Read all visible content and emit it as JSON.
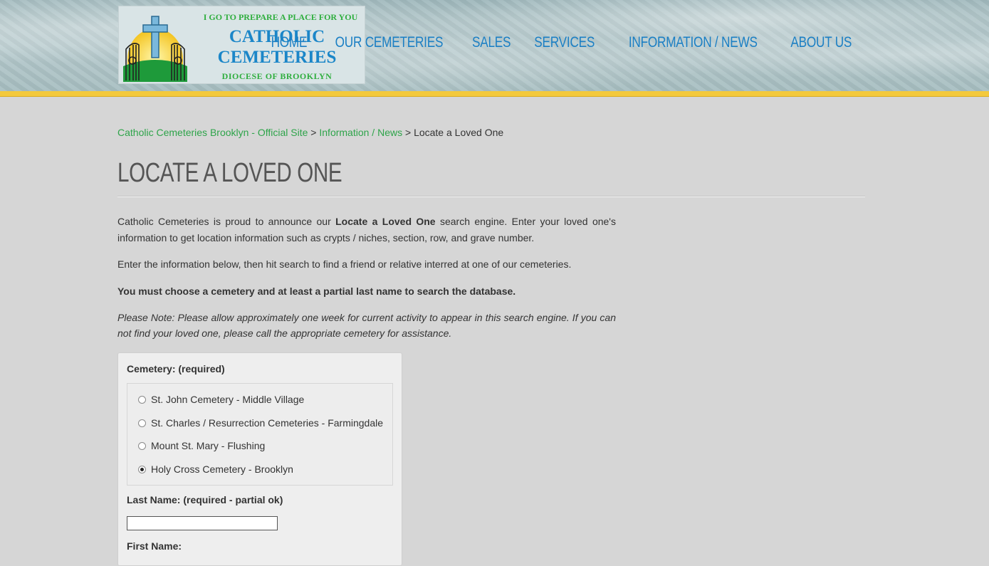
{
  "logo": {
    "tagline": "I GO TO PREPARE A PLACE FOR YOU",
    "name_line1": "CATHOLIC",
    "name_line2": "CEMETERIES",
    "diocese": "DIOCESE OF BROOKLYN",
    "icon": "cross-gate-logo-icon"
  },
  "nav": {
    "items": [
      "HOME",
      "OUR CEMETERIES",
      "SALES",
      "SERVICES",
      "INFORMATION / NEWS",
      "ABOUT US"
    ]
  },
  "breadcrumb": {
    "home": "Catholic Cemeteries Brooklyn - Official Site",
    "sep": " > ",
    "section": "Information / News",
    "current": "Locate a Loved One"
  },
  "page": {
    "title": "LOCATE A LOVED ONE",
    "p1_a": "Catholic Cemeteries is proud to announce our ",
    "p1_bold": "Locate a Loved One",
    "p1_b": " search engine. Enter your loved one's information to get location information such as crypts / niches, section, row, and grave number.",
    "p2": "Enter the information below, then hit search to find a friend or relative interred at one of our cemeteries.",
    "p3": "You must choose a cemetery and at least a partial last name to search the database.",
    "p4": "Please Note: Please allow approximately one week for current activity to appear in this search engine. If you can not find your loved one, please call the appropriate cemetery for assistance."
  },
  "form": {
    "cemetery_label": "Cemetery: (required)",
    "cemeteries": [
      "St. John Cemetery - Middle Village",
      "St. Charles / Resurrection Cemeteries - Farmingdale",
      "Mount St. Mary - Flushing",
      "Holy Cross Cemetery - Brooklyn"
    ],
    "selected_index": 3,
    "last_name_label": "Last Name: (required - partial ok)",
    "last_name_value": "",
    "first_name_label": "First Name:"
  },
  "colors": {
    "nav": "#1b7fc4",
    "link": "#2ea44a",
    "stripe": "#f3c93c",
    "background": "#d6d6d6"
  }
}
